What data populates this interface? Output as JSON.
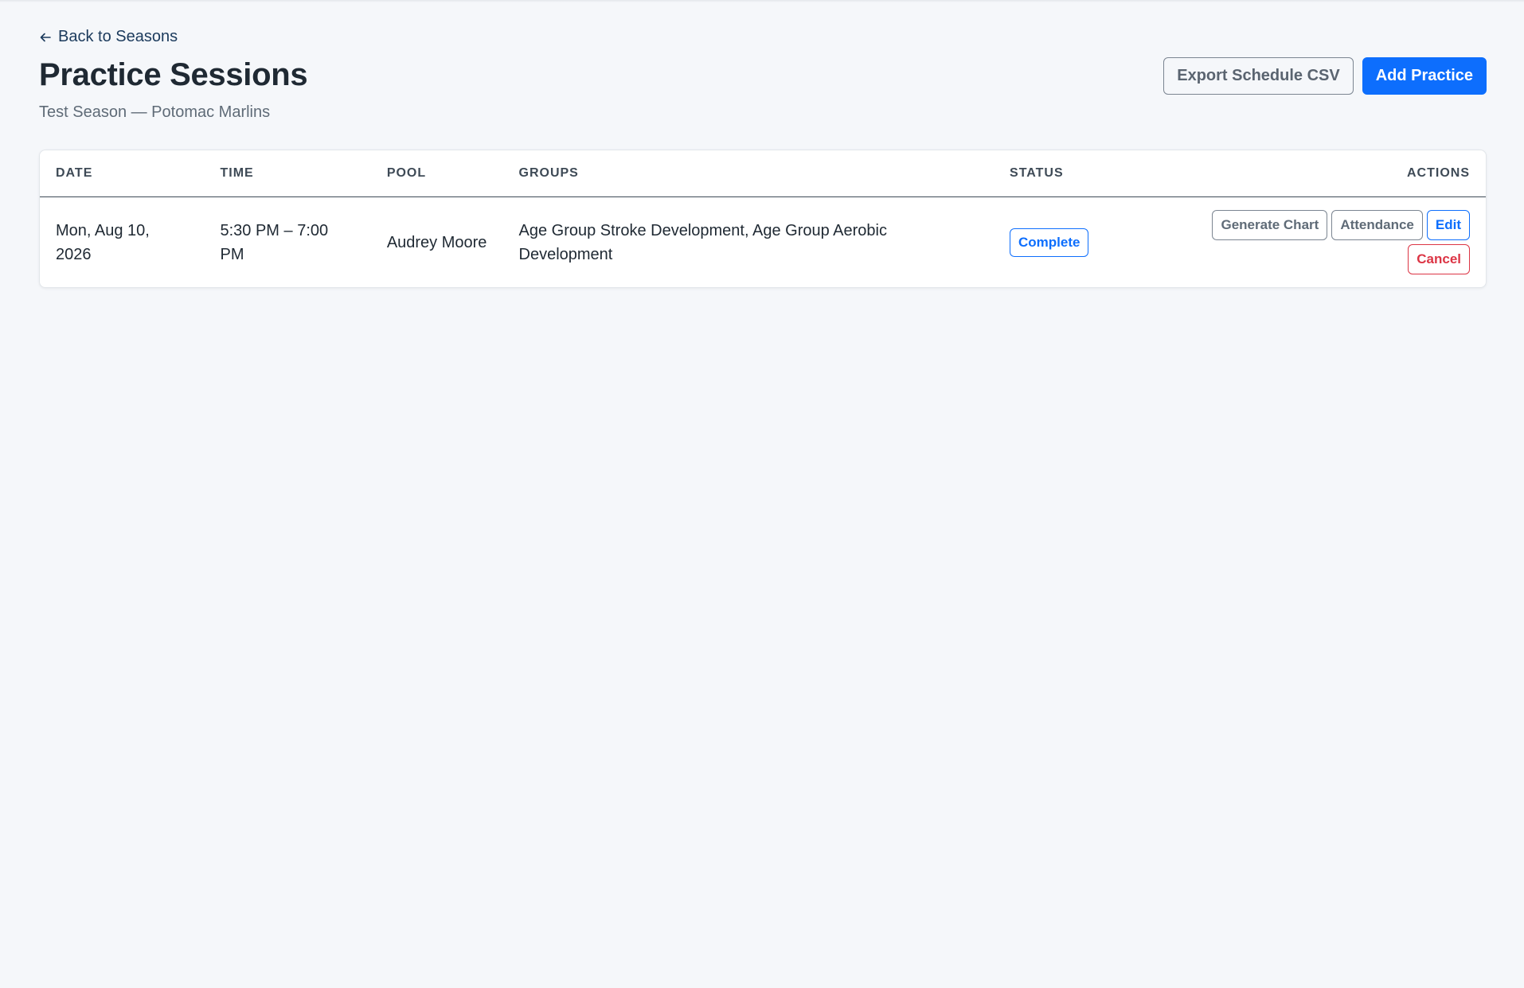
{
  "nav": {
    "back_label": "Back to Seasons"
  },
  "header": {
    "title": "Practice Sessions",
    "subtitle": "Test Season — Potomac Marlins",
    "export_label": "Export Schedule CSV",
    "add_label": "Add Practice"
  },
  "table": {
    "columns": {
      "date": "DATE",
      "time": "TIME",
      "pool": "POOL",
      "groups": "GROUPS",
      "status": "STATUS",
      "actions": "ACTIONS"
    },
    "rows": [
      {
        "date": "Mon, Aug 10, 2026",
        "time": "5:30 PM – 7:00 PM",
        "pool": "Audrey Moore",
        "groups": "Age Group Stroke Development, Age Group Aerobic Development",
        "status": "Complete",
        "actions": {
          "generate_chart": "Generate Chart",
          "attendance": "Attendance",
          "edit": "Edit",
          "cancel": "Cancel"
        }
      }
    ]
  },
  "colors": {
    "primary": "#0d6efd",
    "danger": "#dc3545",
    "background": "#f5f7fa"
  }
}
